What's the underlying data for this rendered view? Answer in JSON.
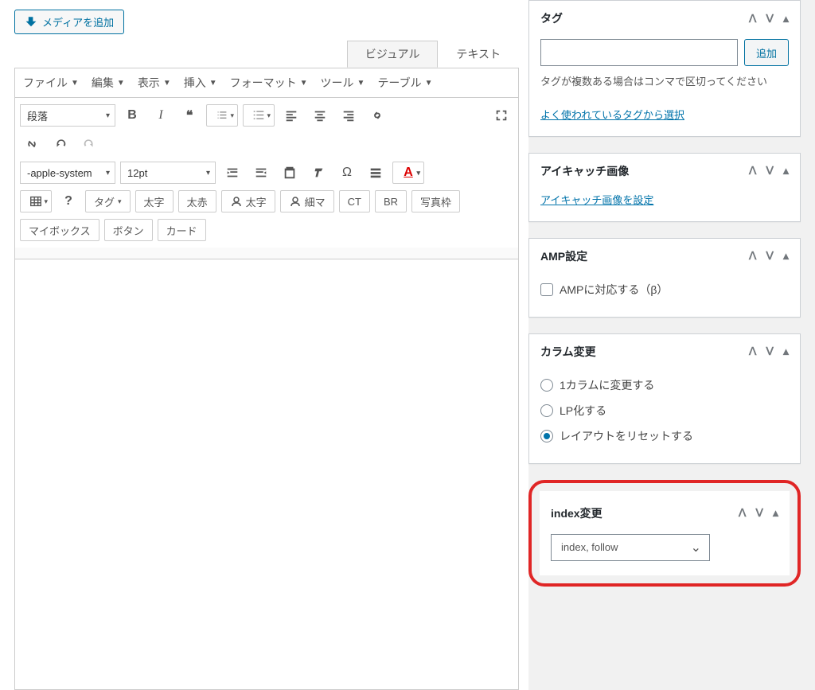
{
  "editor": {
    "add_media": "メディアを追加",
    "tabs": {
      "visual": "ビジュアル",
      "text": "テキスト"
    },
    "menu": {
      "file": "ファイル",
      "edit": "編集",
      "view": "表示",
      "insert": "挿入",
      "format": "フォーマット",
      "tools": "ツール",
      "table": "テーブル"
    },
    "toolbar": {
      "paragraph": "段落",
      "font_family": "-apple-system",
      "font_size": "12pt",
      "tag_btn": "タグ",
      "bold_btn": "太字",
      "boldred_btn": "太赤",
      "circlebold_btn": "太字",
      "circleslim_btn": "細マ",
      "ct_btn": "CT",
      "br_btn": "BR",
      "photoframe_btn": "写真枠",
      "mybox_btn": "マイボックス",
      "button_btn": "ボタン",
      "card_btn": "カード"
    }
  },
  "side": {
    "tag": {
      "title": "タグ",
      "add": "追加",
      "hint": "タグが複数ある場合はコンマで区切ってください",
      "link": "よく使われているタグから選択"
    },
    "featured": {
      "title": "アイキャッチ画像",
      "link": "アイキャッチ画像を設定"
    },
    "amp": {
      "title": "AMP設定",
      "checkbox": "AMPに対応する（β）"
    },
    "column": {
      "title": "カラム変更",
      "opt1": "1カラムに変更する",
      "opt2": "LP化する",
      "opt3": "レイアウトをリセットする"
    },
    "index": {
      "title": "index変更",
      "value": "index, follow"
    }
  }
}
